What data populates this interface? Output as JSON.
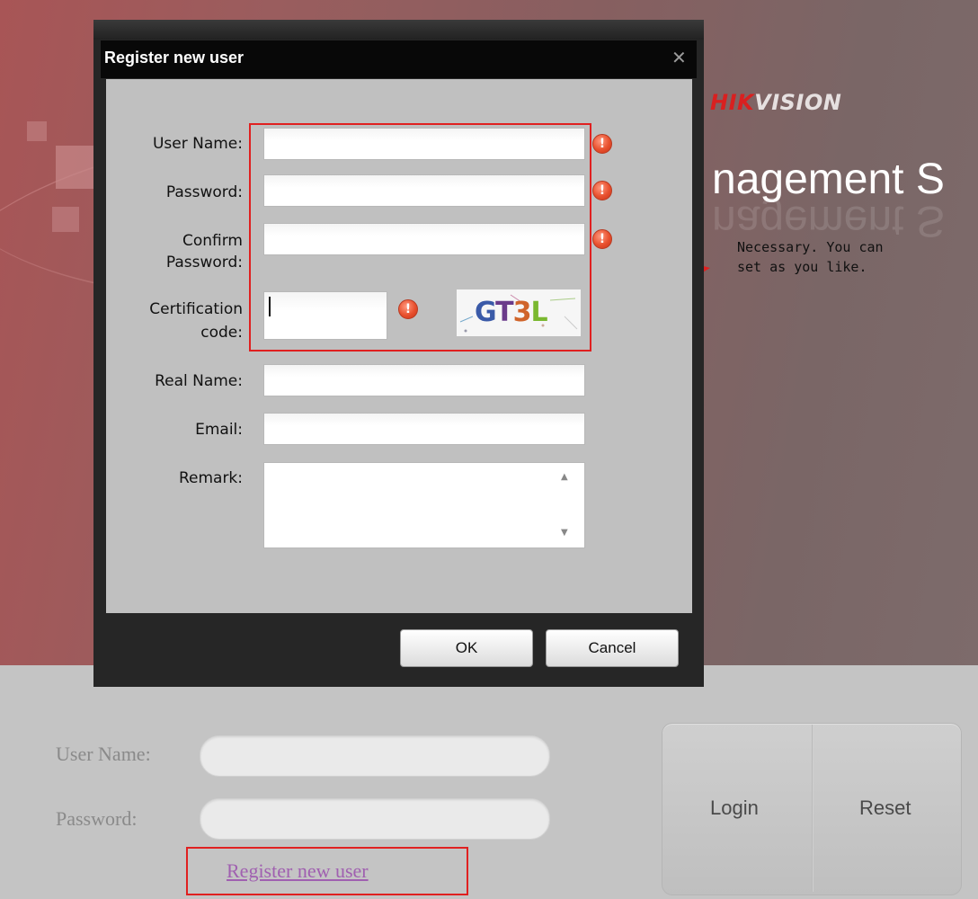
{
  "background": {
    "logo_hik": "HIK",
    "logo_vision": "VISION",
    "title_fragment": "nagement S",
    "login": {
      "username_label": "User Name:",
      "password_label": "Password:",
      "login_button": "Login",
      "reset_button": "Reset",
      "register_link": "Register new user"
    }
  },
  "annotation": {
    "text": "Necessary. You can\nset as you like."
  },
  "dialog": {
    "title": "Register new user",
    "close_icon": "close-icon",
    "fields": {
      "username": {
        "label": "User Name:",
        "value": ""
      },
      "password": {
        "label": "Password:",
        "value": ""
      },
      "confirm": {
        "label_line1": "Confirm",
        "label_line2": "Password:",
        "value": ""
      },
      "cert": {
        "label_line1": "Certification",
        "label_line2": "code:",
        "value": ""
      },
      "realname": {
        "label": "Real Name:",
        "value": ""
      },
      "email": {
        "label": "Email:",
        "value": ""
      },
      "remark": {
        "label": "Remark:",
        "value": ""
      }
    },
    "warning_icon": "!",
    "captcha": {
      "text_g": "G",
      "text_t": "T",
      "text_3": "3",
      "text_l": "L"
    },
    "buttons": {
      "ok": "OK",
      "cancel": "Cancel"
    }
  },
  "colors": {
    "highlight_box": "#e02020",
    "warning": "#e8502e",
    "link": "#a060b0"
  }
}
